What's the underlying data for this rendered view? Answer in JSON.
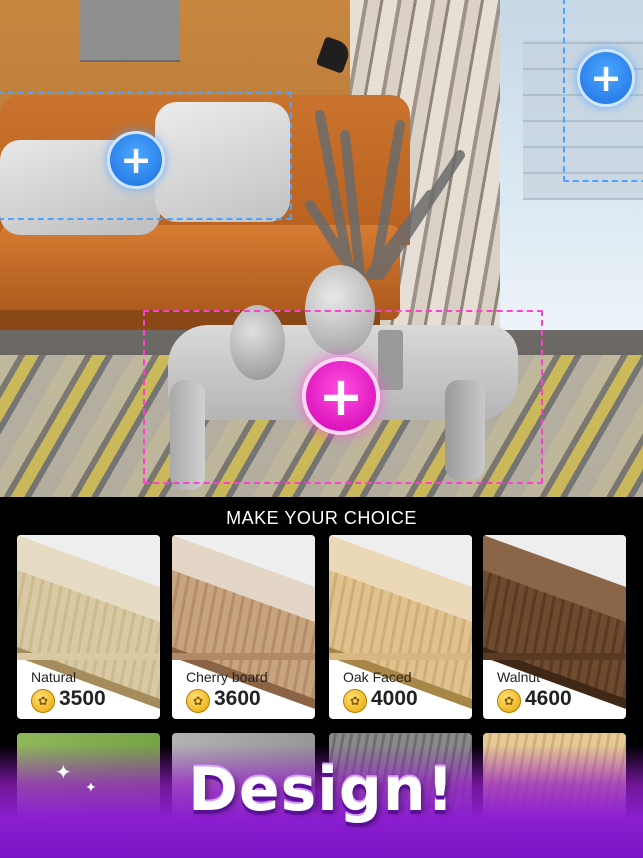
{
  "choice_panel": {
    "title": "MAKE YOUR CHOICE",
    "options": [
      {
        "name": "Natural",
        "price": "3500",
        "color_top": "#d9c9a3",
        "color_edge": "#a48c5c"
      },
      {
        "name": "Cherry board",
        "price": "3600",
        "color_top": "#c7a37e",
        "color_edge": "#8a6445"
      },
      {
        "name": "Oak Faced",
        "price": "4000",
        "color_top": "#e0c28f",
        "color_edge": "#a88648"
      },
      {
        "name": "Walnut",
        "price": "4600",
        "color_top": "#6e4a2f",
        "color_edge": "#3f2816"
      }
    ],
    "more_options_colors": [
      "#7aa84a",
      "#9e9e9e",
      "#7d7d7d",
      "#e0c28f"
    ]
  },
  "banner": {
    "text": "Design!"
  },
  "hotspots": {
    "symbol": "+",
    "colors": {
      "blue": "#2c8bf2",
      "pink": "#ff26d6"
    }
  }
}
